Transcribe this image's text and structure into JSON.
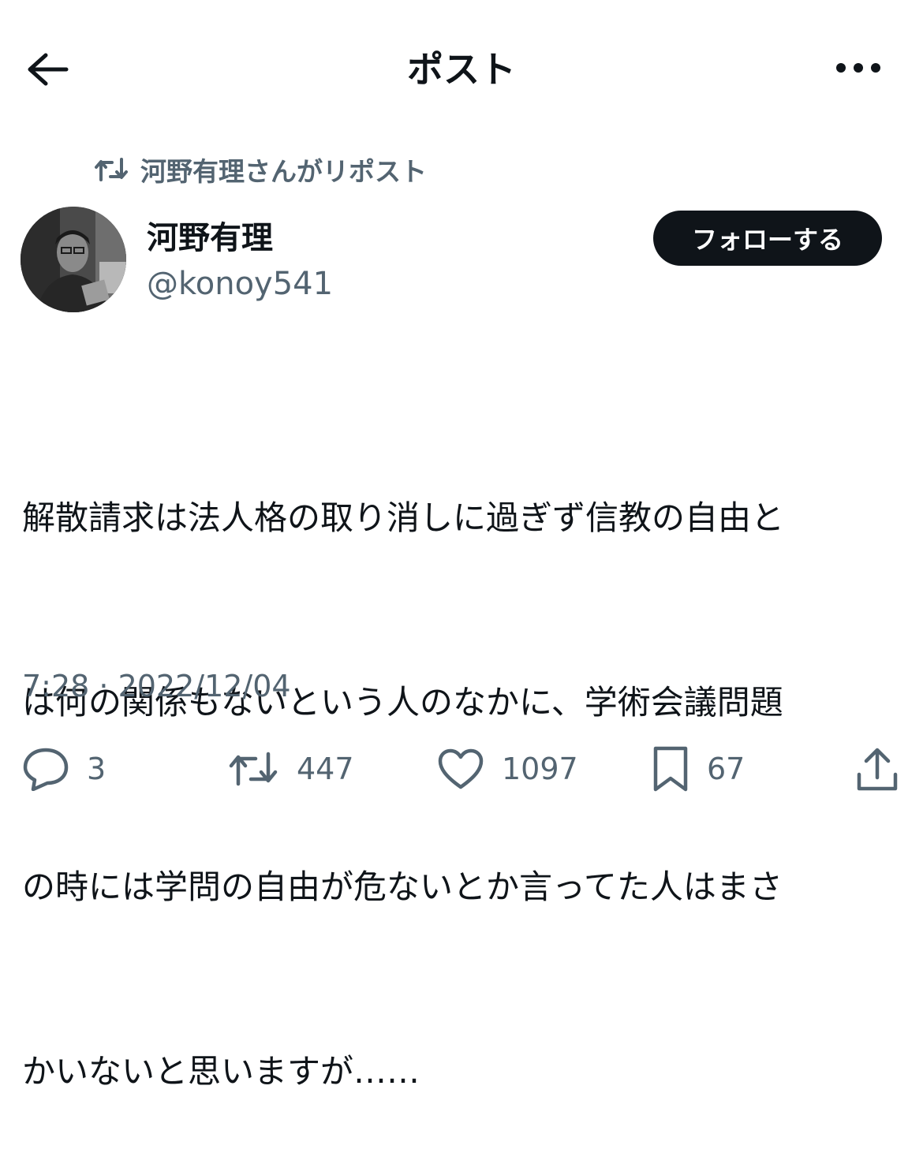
{
  "header": {
    "title": "ポスト",
    "back_icon": "back-arrow-icon",
    "more_icon": "more-horizontal-icon"
  },
  "repost": {
    "text": "河野有理さんがリポスト",
    "icon": "repost-icon"
  },
  "author": {
    "display_name": "河野有理",
    "handle": "@konoy541",
    "follow_label": "フォローする"
  },
  "tweet": {
    "lines": [
      "解散請求は法人格の取り消しに過ぎず信教の自由と",
      "は何の関係もないという人のなかに、学術会議問題",
      "の時には学問の自由が危ないとか言ってた人はまさ",
      "かいないと思いますが……"
    ],
    "timestamp": "7:28 · 2022/12/04"
  },
  "actions": {
    "reply_count": "3",
    "repost_count": "447",
    "like_count": "1097",
    "bookmark_count": "67"
  },
  "colors": {
    "text_primary": "#0f1419",
    "text_secondary": "#536471",
    "follow_bg": "#0f1419"
  }
}
